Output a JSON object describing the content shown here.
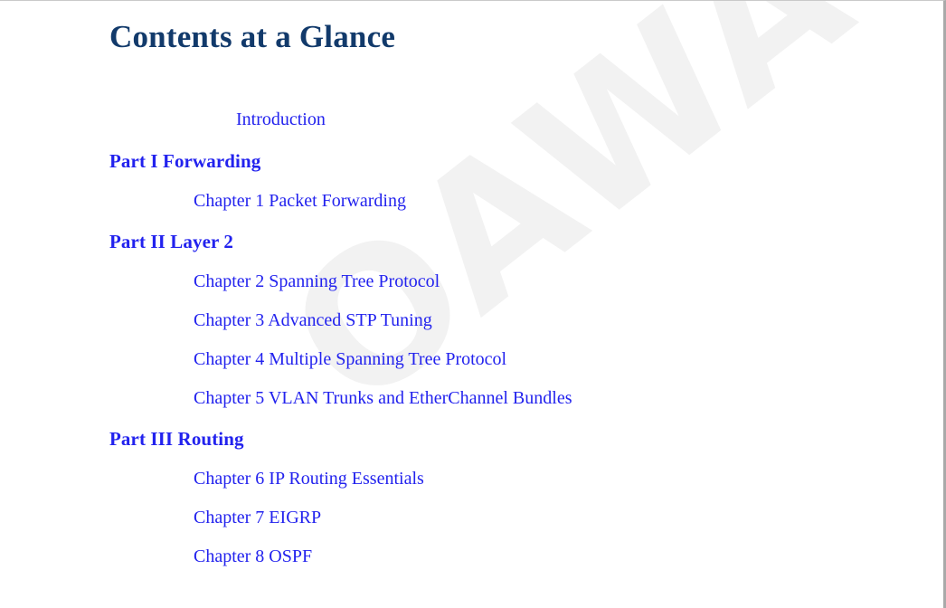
{
  "document": {
    "title": "Contents at a Glance",
    "title_color": "#123a6b",
    "entry_color": "#2222ee",
    "background_color": "#ffffff"
  },
  "watermark": {
    "text": "OAWAY",
    "color": "#f2f2f2",
    "rotation_degrees": -38
  },
  "toc": {
    "entries": [
      {
        "label": "Introduction",
        "level": "front"
      },
      {
        "label": "Part I Forwarding",
        "level": "part"
      },
      {
        "label": "Chapter 1 Packet Forwarding",
        "level": "chapter"
      },
      {
        "label": "Part II Layer 2",
        "level": "part"
      },
      {
        "label": "Chapter 2 Spanning Tree Protocol",
        "level": "chapter"
      },
      {
        "label": "Chapter 3 Advanced STP Tuning",
        "level": "chapter"
      },
      {
        "label": "Chapter 4 Multiple Spanning Tree Protocol",
        "level": "chapter"
      },
      {
        "label": "Chapter 5 VLAN Trunks and EtherChannel Bundles",
        "level": "chapter"
      },
      {
        "label": "Part III Routing",
        "level": "part"
      },
      {
        "label": "Chapter 6 IP Routing Essentials",
        "level": "chapter"
      },
      {
        "label": "Chapter 7 EIGRP",
        "level": "chapter"
      },
      {
        "label": "Chapter 8 OSPF",
        "level": "chapter"
      }
    ]
  }
}
